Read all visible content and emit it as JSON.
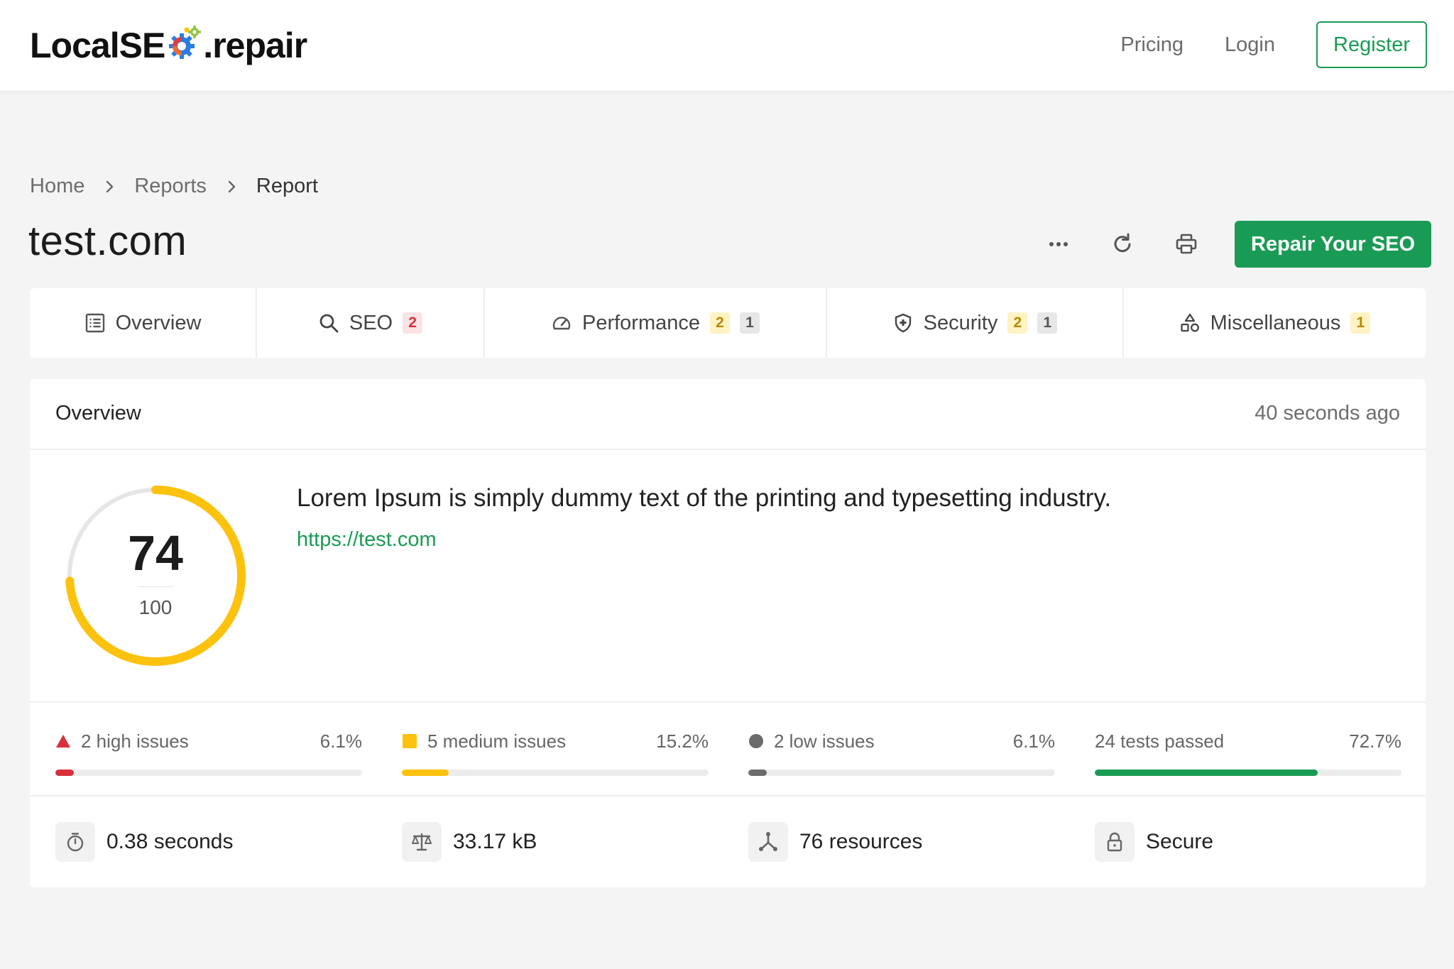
{
  "nav": {
    "logo_before": "LocalSE",
    "logo_after": ".repair",
    "pricing": "Pricing",
    "login": "Login",
    "register": "Register"
  },
  "breadcrumb": {
    "home": "Home",
    "reports": "Reports",
    "current": "Report"
  },
  "page": {
    "title": "test.com",
    "more_icon": "more-horizontal-icon",
    "refresh_icon": "refresh-icon",
    "print_icon": "printer-icon",
    "repair_button": "Repair Your SEO"
  },
  "tabs": [
    {
      "label": "Overview",
      "icon": "list-icon"
    },
    {
      "label": "SEO",
      "icon": "search-icon",
      "badges": [
        "2"
      ]
    },
    {
      "label": "Performance",
      "icon": "speedometer-icon",
      "badges": [
        "2",
        "1"
      ]
    },
    {
      "label": "Security",
      "icon": "shield-icon",
      "badges": [
        "2",
        "1"
      ]
    },
    {
      "label": "Miscellaneous",
      "icon": "shapes-icon",
      "badges": [
        "1"
      ]
    }
  ],
  "overview": {
    "title": "Overview",
    "timestamp": "40 seconds ago",
    "score": "74",
    "score_max": "100",
    "score_fraction": 0.74,
    "description": "Lorem Ipsum is simply dummy text of the printing and typesetting industry.",
    "url": "https://test.com"
  },
  "issues": [
    {
      "label": "2 high issues",
      "percent": "6.1%",
      "fraction": 0.061,
      "color": "#d8303c"
    },
    {
      "label": "5 medium issues",
      "percent": "15.2%",
      "fraction": 0.152,
      "color": "#fdc20d"
    },
    {
      "label": "2 low issues",
      "percent": "6.1%",
      "fraction": 0.061,
      "color": "#6b6b6b"
    },
    {
      "label": "24 tests passed",
      "percent": "72.7%",
      "fraction": 0.727,
      "color": "#1a9b55"
    }
  ],
  "stats": [
    {
      "text": "0.38 seconds",
      "icon": "timer-icon"
    },
    {
      "text": "33.17 kB",
      "icon": "scale-icon"
    },
    {
      "text": "76 resources",
      "icon": "resources-icon"
    },
    {
      "text": "Secure",
      "icon": "lock-icon"
    }
  ],
  "colors": {
    "brand_green": "#1a9b55",
    "score_ring": "#fdc20d",
    "ring_track": "#e6e6e6",
    "background": "#f4f4f4"
  }
}
